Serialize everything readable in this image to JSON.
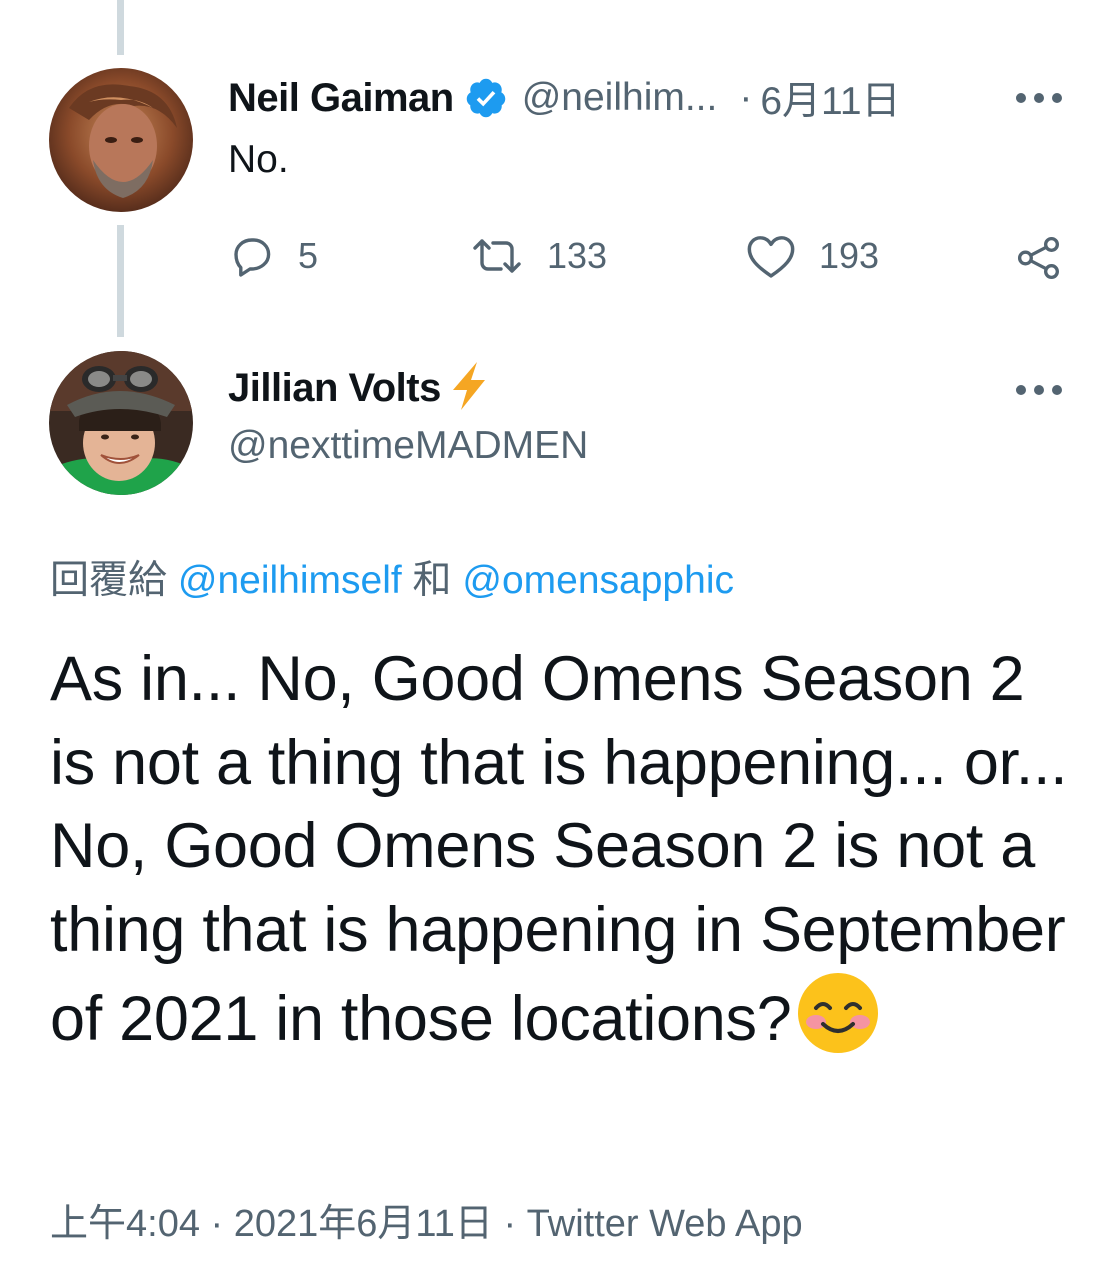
{
  "tweet_parent": {
    "author_name": "Neil Gaiman",
    "author_handle": "@neilhim...",
    "separator": "·",
    "date": "6月11日",
    "verified": true,
    "text": "No.",
    "reply_count": "5",
    "retweet_count": "133",
    "like_count": "193"
  },
  "tweet_main": {
    "author_name": "Jillian Volts",
    "author_handle": "@nexttimeMADMEN",
    "reply_to_prefix": "回覆給",
    "reply_to_first": "@neilhimself",
    "reply_to_joiner": "和",
    "reply_to_second": "@omensapphic",
    "text": "As in... No, Good Omens Season 2 is not a thing that is happening... or... No, Good Omens Season 2 is not a thing that is happening in September of 2021 in those locations?",
    "time": "上午4:04",
    "date": "2021年6月11日",
    "separator": "·",
    "source": "Twitter Web App"
  },
  "icons": {
    "verified": "verified-badge-icon",
    "more": "more-icon",
    "reply": "reply-icon",
    "retweet": "retweet-icon",
    "like": "heart-icon",
    "share": "share-icon",
    "bolt": "lightning-bolt-emoji",
    "smile": "smiling-face-emoji"
  },
  "colors": {
    "link": "#1d9bf0",
    "muted": "#536471",
    "text": "#0f1419",
    "thread_line": "#cfd9de",
    "bolt": "#f5a623"
  }
}
